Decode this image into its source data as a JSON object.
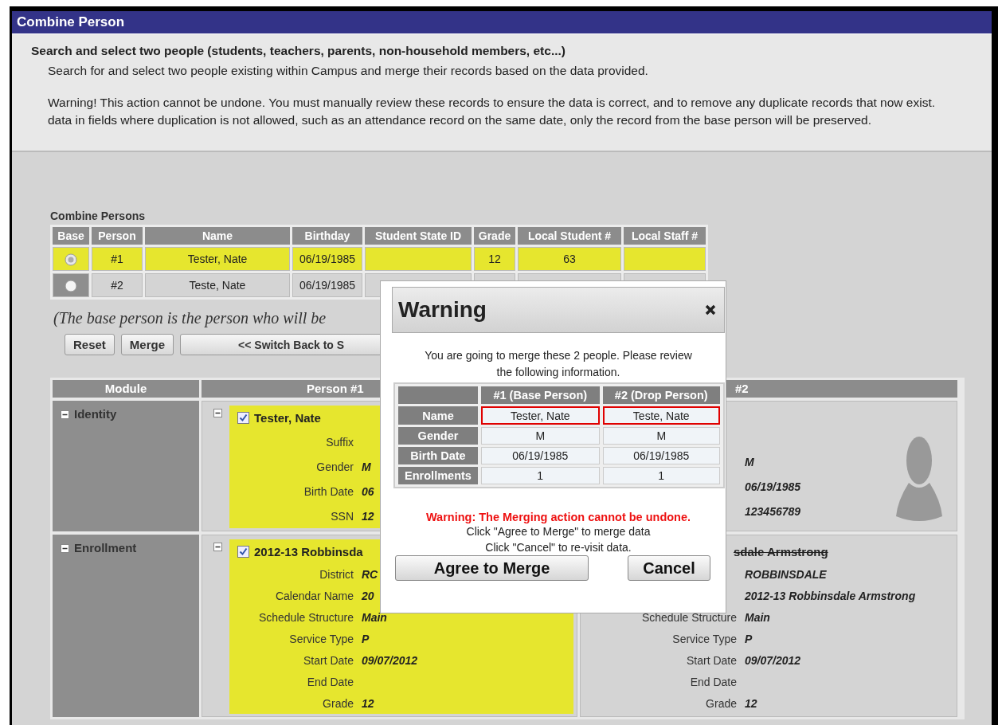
{
  "window": {
    "title": "Combine Person"
  },
  "intro": {
    "heading": "Search and select two people (students, teachers, parents, non-household members, etc...)",
    "description": "Search for and select two people existing within Campus and merge their records based on the data provided.",
    "warning_lines": [
      "Warning! This action cannot be undone. You must manually review these records to ensure the data is correct, and to remove any duplicate records that now exist.",
      "data in fields where duplication is not allowed, such as an attendance record on the same date, only the record from the base person will be preserved."
    ]
  },
  "combine_table": {
    "title": "Combine Persons",
    "columns": [
      "Base",
      "Person",
      "Name",
      "Birthday",
      "Student State ID",
      "Grade",
      "Local Student #",
      "Local Staff #"
    ],
    "rows": [
      {
        "selected": true,
        "person": "#1",
        "name": "Tester, Nate",
        "birthday": "06/19/1985",
        "grade": "12",
        "local_student_number": "63"
      },
      {
        "selected": false,
        "person": "#2",
        "name": "Teste, Nate",
        "birthday": "06/19/1985"
      }
    ]
  },
  "base_note": "(The base person is the person who will be",
  "buttons": [
    "Reset",
    "Merge",
    "<< Switch Back to S"
  ],
  "compare": {
    "columns": [
      "Module",
      "Person #1",
      "#2"
    ],
    "modules": [
      {
        "kind": "identity",
        "name": "Identity",
        "expanded": true,
        "person_1": {
          "expanded": true,
          "checked": true,
          "title": "Tester, Nate",
          "struck": false,
          "fields": [
            {
              "label": "Suffix"
            },
            {
              "label": "Gender",
              "value": "M"
            },
            {
              "label": "Birth Date",
              "value": "06"
            },
            {
              "label": "SSN",
              "value": "12"
            }
          ]
        },
        "person_2": {
          "avatar": true,
          "fields": [
            {
              "value": "M"
            },
            {
              "value": "06/19/1985"
            },
            {
              "value": "123456789"
            }
          ]
        }
      },
      {
        "kind": "enrollment",
        "name": "Enrollment",
        "expanded": true,
        "person_1": {
          "expanded": true,
          "checked": true,
          "title": "2012-13 Robbinsda",
          "struck": false,
          "fields": [
            {
              "label": "District",
              "value": "RC"
            },
            {
              "label": "Calendar Name",
              "value": "20"
            },
            {
              "label": "Schedule Structure",
              "value": "Main"
            },
            {
              "label": "Service Type",
              "value": "P"
            },
            {
              "label": "Start Date",
              "value": "09/07/2012"
            },
            {
              "label": "End Date"
            },
            {
              "label": "Grade",
              "value": "12"
            }
          ]
        },
        "person_2": {
          "title": "sdale Armstrong",
          "struck": true,
          "fields": [
            {
              "value": "ROBBINSDALE"
            },
            {
              "value": "2012-13 Robbinsdale Armstrong"
            },
            {
              "label": "Schedule Structure",
              "value": "Main"
            },
            {
              "label": "Service Type",
              "value": "P"
            },
            {
              "label": "Start Date",
              "value": "09/07/2012"
            },
            {
              "label": "End Date"
            },
            {
              "label": "Grade",
              "value": "12"
            }
          ]
        }
      }
    ]
  },
  "dialog": {
    "title": "Warning",
    "message": "You are going to merge these 2 people. Please review the following information.",
    "table": {
      "columns": [
        "#1 (Base Person)",
        "#2 (Drop Person)"
      ],
      "rows": [
        {
          "label": "Name",
          "mismatch": true,
          "values": [
            "Tester, Nate",
            "Teste, Nate"
          ]
        },
        {
          "label": "Gender",
          "mismatch": false,
          "values": [
            "M",
            "M"
          ]
        },
        {
          "label": "Birth Date",
          "mismatch": false,
          "values": [
            "06/19/1985",
            "06/19/1985"
          ]
        },
        {
          "label": "Enrollments",
          "mismatch": false,
          "values": [
            "1",
            "1"
          ]
        }
      ]
    },
    "alert": "Warning: The Merging action cannot be undone.",
    "instructions": [
      "Click \"Agree to Merge\" to merge data",
      "Click \"Cancel\" to re-visit data."
    ],
    "buttons": [
      "Agree to Merge",
      "Cancel"
    ]
  }
}
